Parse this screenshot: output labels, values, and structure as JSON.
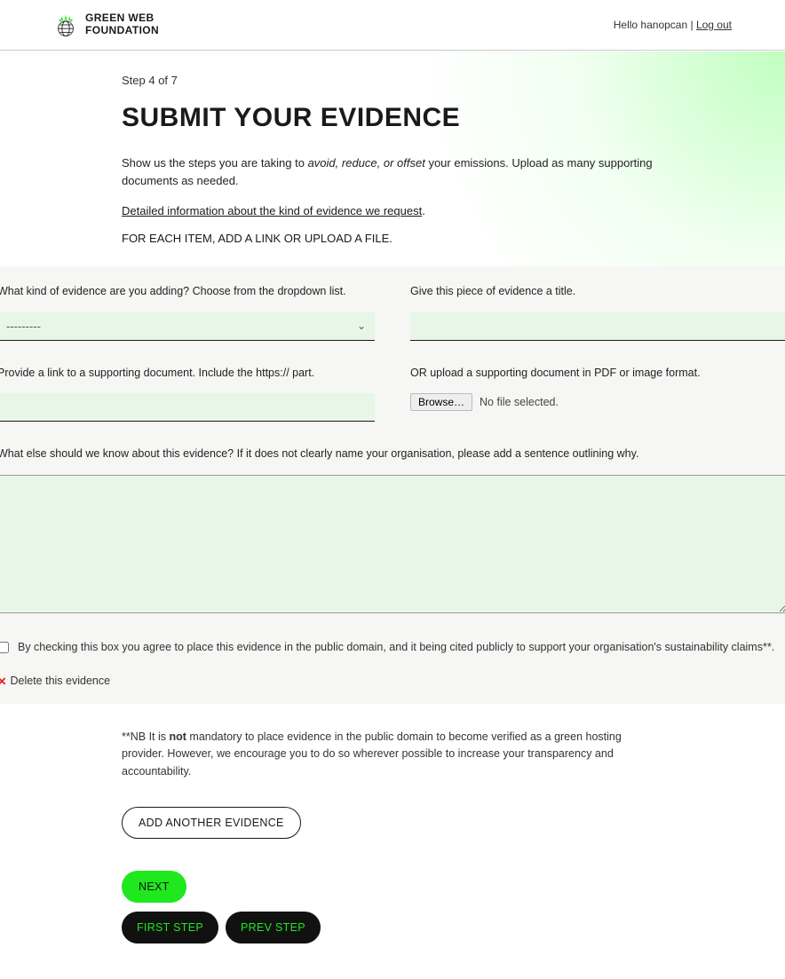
{
  "header": {
    "brand_line1": "GREEN WEB",
    "brand_line2": "FOUNDATION",
    "greeting": "Hello hanopcan",
    "separator": " | ",
    "logout": "Log out"
  },
  "page": {
    "step": "Step 4 of 7",
    "title": "SUBMIT YOUR EVIDENCE",
    "intro_before": "Show us the steps you are taking to ",
    "intro_em": "avoid, reduce, or offset",
    "intro_after": " your emissions. Upload as many supporting documents as needed.",
    "detail_link": "Detailed information about the kind of evidence we request",
    "instructions": "FOR EACH ITEM, ADD A LINK OR UPLOAD A FILE."
  },
  "form": {
    "kind_label": "What kind of evidence are you adding? Choose from the dropdown list.",
    "kind_placeholder": "---------",
    "title_label": "Give this piece of evidence a title.",
    "link_label": "Provide a link to a supporting document. Include the https:// part.",
    "upload_label": "OR upload a supporting document in PDF or image format.",
    "browse_btn": "Browse…",
    "no_file": "No file selected.",
    "notes_label": "What else should we know about this evidence? If it does not clearly name your organisation, please add a sentence outlining why.",
    "consent": "By checking this box you agree to place this evidence in the public domain, and it being cited publicly to support your organisation's sustainability claims**.",
    "delete": "Delete this evidence"
  },
  "footnote": {
    "prefix": "**NB It is ",
    "bold": "not",
    "rest": " mandatory to place evidence in the public domain to become verified as a green hosting provider. However, we encourage you to do so wherever possible to increase your transparency and accountability."
  },
  "buttons": {
    "add": "ADD ANOTHER EVIDENCE",
    "next": "NEXT",
    "first": "FIRST STEP",
    "prev": "PREV STEP"
  }
}
